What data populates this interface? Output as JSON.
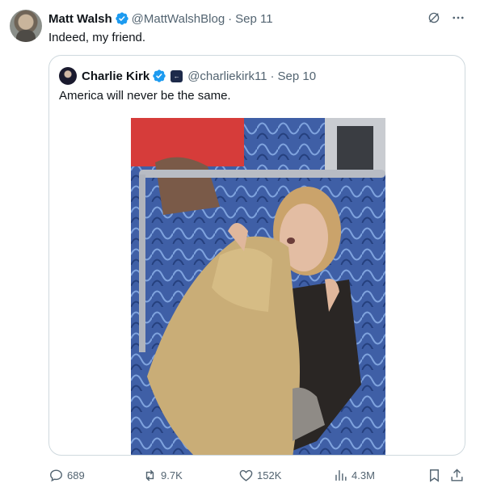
{
  "tweet": {
    "author_name": "Matt Walsh",
    "handle": "@MattWalshBlog",
    "separator": "·",
    "date": "Sep 11",
    "text": "Indeed, my friend."
  },
  "quote": {
    "author_name": "Charlie Kirk",
    "handle": "@charliekirk11",
    "separator": "·",
    "date": "Sep 10",
    "text": "America will never be the same."
  },
  "actions": {
    "replies": "689",
    "reposts": "9.7K",
    "likes": "152K",
    "views": "4.3M"
  },
  "colors": {
    "verified": "#1d9bf0",
    "muted": "#536471",
    "border": "#cfd9de"
  },
  "icons": [
    "verified-badge-icon",
    "grok-icon",
    "more-icon",
    "reply-icon",
    "repost-icon",
    "like-icon",
    "views-icon",
    "bookmark-icon",
    "share-icon"
  ]
}
